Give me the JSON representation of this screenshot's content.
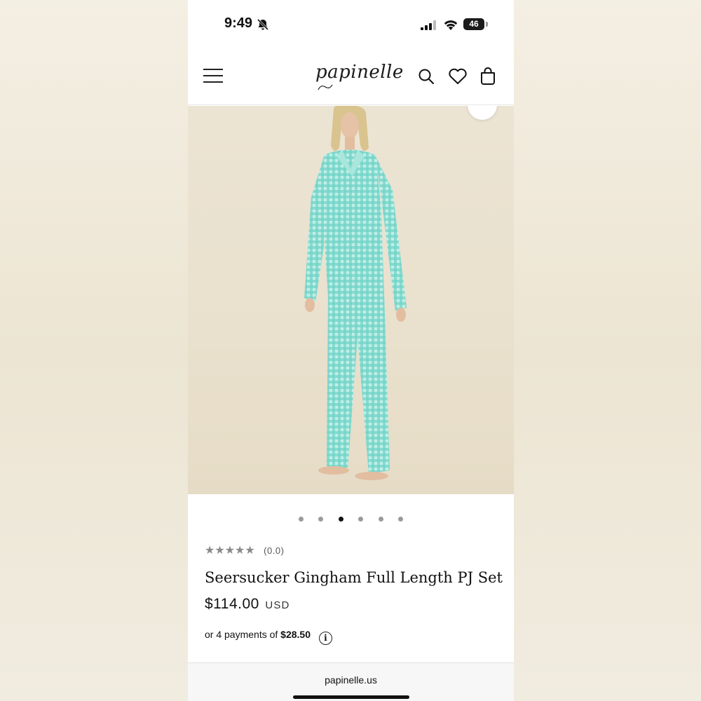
{
  "status_bar": {
    "time": "9:49",
    "battery": "46"
  },
  "header": {
    "logo": "papinelle",
    "icons": [
      "menu-icon",
      "search-icon",
      "heart-icon",
      "bag-icon"
    ]
  },
  "gallery": {
    "slide_count": 6,
    "active_index": 2
  },
  "product": {
    "stars": "★★★★★",
    "rating_text": "(0.0)",
    "title": "Seersucker Gingham Full Length PJ Set",
    "price": "$114.00",
    "currency": "USD",
    "installments_prefix": "or 4 payments of",
    "installments_amount": "$28.50",
    "info_glyph": "i"
  },
  "browser": {
    "url": "papinelle.us"
  },
  "colors": {
    "gingham": "#5fcfc3",
    "backdrop": "#ece4d3",
    "text": "#111111"
  }
}
